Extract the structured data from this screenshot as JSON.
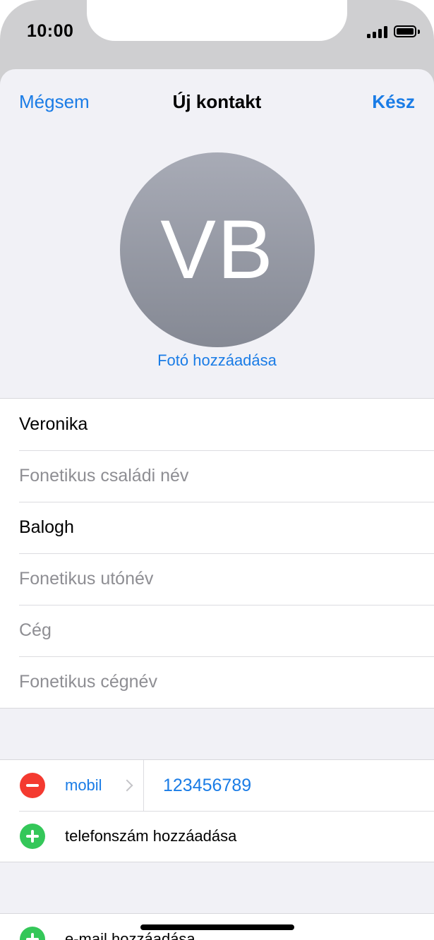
{
  "status_bar": {
    "time": "10:00"
  },
  "nav": {
    "cancel": "Mégsem",
    "title": "Új kontakt",
    "done": "Kész"
  },
  "avatar": {
    "initials": "VB",
    "add_photo": "Fotó hozzáadása"
  },
  "name_fields": [
    {
      "text": "Veronika",
      "kind": "value"
    },
    {
      "text": "Fonetikus családi név",
      "kind": "placeholder"
    },
    {
      "text": "Balogh",
      "kind": "value"
    },
    {
      "text": "Fonetikus utónév",
      "kind": "placeholder"
    },
    {
      "text": "Cég",
      "kind": "placeholder"
    },
    {
      "text": "Fonetikus cégnév",
      "kind": "placeholder"
    }
  ],
  "phone": {
    "type_label": "mobil",
    "number": "123456789",
    "add_label": "telefonszám hozzáadása"
  },
  "email": {
    "add_label": "e-mail hozzáadása"
  },
  "colors": {
    "accent": "#1a7ce6",
    "remove": "#f43a30",
    "add": "#34c759"
  }
}
